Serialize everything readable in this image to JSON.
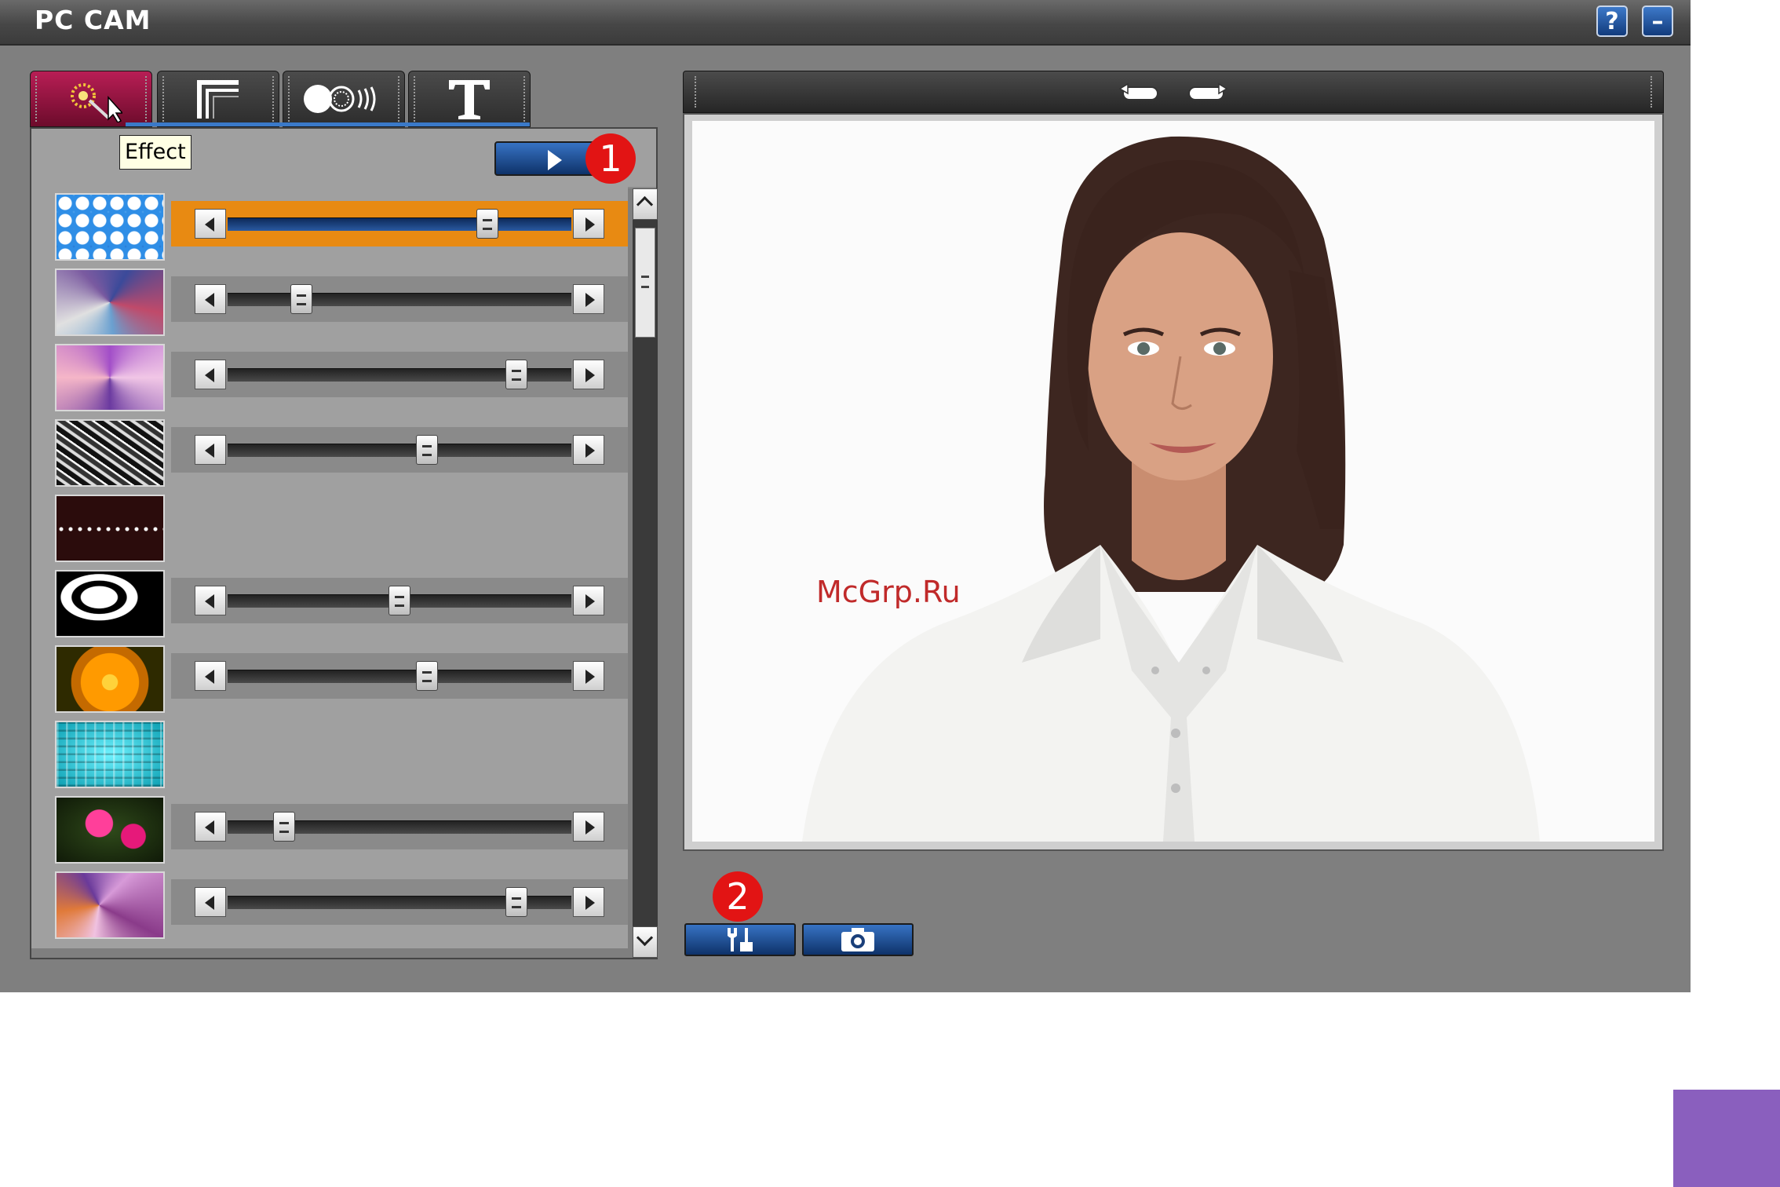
{
  "window": {
    "title": "PC CAM",
    "help_label": "?",
    "minimize_label": "–"
  },
  "tabs": [
    {
      "name": "effect",
      "icon": "sparkle-wand-icon",
      "active": true
    },
    {
      "name": "frame",
      "icon": "frame-corner-icon",
      "active": false
    },
    {
      "name": "animation",
      "icon": "motion-dots-icon",
      "active": false
    },
    {
      "name": "text",
      "icon": "text-t-icon",
      "active": false
    }
  ],
  "tooltip": {
    "text": "Effect"
  },
  "badges": {
    "one": "1",
    "two": "2"
  },
  "effects": [
    {
      "thumb": "blue-bubble-pattern",
      "slider": 0.755,
      "has_slider": true,
      "selected": true
    },
    {
      "thumb": "mosaic-tiles",
      "slider": 0.215,
      "has_slider": true,
      "selected": false
    },
    {
      "thumb": "purple-swirl",
      "slider": 0.84,
      "has_slider": true,
      "selected": false
    },
    {
      "thumb": "black-white-noise",
      "slider": 0.58,
      "has_slider": true,
      "selected": false
    },
    {
      "thumb": "film-strip",
      "slider": null,
      "has_slider": false,
      "selected": false
    },
    {
      "thumb": "bw-threshold-flower",
      "slider": 0.5,
      "has_slider": true,
      "selected": false
    },
    {
      "thumb": "orange-flower",
      "slider": 0.58,
      "has_slider": true,
      "selected": false
    },
    {
      "thumb": "cyan-grid",
      "slider": null,
      "has_slider": false,
      "selected": false
    },
    {
      "thumb": "pink-flowers",
      "slider": 0.165,
      "has_slider": true,
      "selected": false
    },
    {
      "thumb": "purple-cells",
      "slider": 0.84,
      "has_slider": true,
      "selected": false
    }
  ],
  "preview": {
    "watermark": "McGrp.Ru",
    "rotate_left_icon": "rotate-left-icon",
    "rotate_right_icon": "rotate-right-icon"
  },
  "bottom_buttons": [
    {
      "name": "settings",
      "icon": "tools-icon"
    },
    {
      "name": "snapshot",
      "icon": "camera-icon"
    }
  ],
  "colors": {
    "accent_tab": "#b81e55",
    "selected_row": "#e88a12",
    "button_blue": "#2c66b6",
    "badge_red": "#e21414"
  }
}
